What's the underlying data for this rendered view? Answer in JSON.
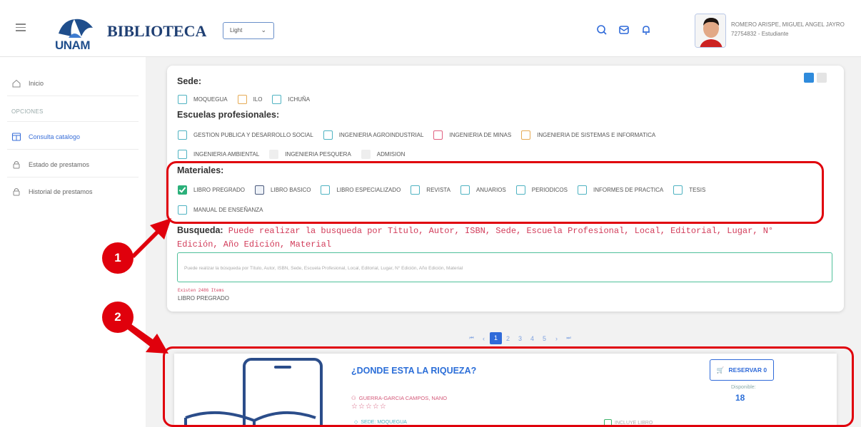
{
  "header": {
    "logo_text": "UNAM",
    "brand": "BIBLIOTECA",
    "theme_select": "Light",
    "user_name": "ROMERO ARISPE, MIGUEL ANGEL JAYRO",
    "user_sub": "72754832 - Estudiante"
  },
  "sidebar": {
    "inicio": "Inicio",
    "section": "OPCIONES",
    "items": [
      "Consulta catalogo",
      "Estado de prestamos",
      "Historial de prestamos"
    ]
  },
  "filters": {
    "sede_label": "Sede:",
    "sedes": [
      "MOQUEGUA",
      "ILO",
      "ICHUÑA"
    ],
    "escuelas_label": "Escuelas profesionales:",
    "escuelas_row1": [
      "GESTION PUBLICA Y DESARROLLO SOCIAL",
      "INGENIERIA AGROINDUSTRIAL",
      "INGENIERIA DE MINAS",
      "INGENIERIA DE SISTEMAS E INFORMATICA"
    ],
    "escuelas_row2": [
      "INGENIERIA AMBIENTAL",
      "INGENIERIA PESQUERA",
      "ADMISION"
    ],
    "materiales_label": "Materiales:",
    "materiales_row1": [
      "LIBRO PREGRADO",
      "LIBRO BASICO",
      "LIBRO ESPECIALIZADO",
      "REVISTA",
      "ANUARIOS",
      "PERIODICOS",
      "INFORMES DE PRACTICA",
      "TESIS"
    ],
    "materiales_row2": [
      "MANUAL DE ENSEÑANZA"
    ],
    "busqueda_label": "Busqueda:",
    "busqueda_hint": "Puede realizar la busqueda por Titulo, Autor, ISBN, Sede, Escuela Profesional, Local, Editorial, Lugar, N° Edición, Año Edición, Material",
    "search_placeholder": "Puede realizar la búsqueda por Título, Autor, ISBN, Sede, Escuela Profesional, Local, Editorial, Lugar, N° Edición, Año Edición, Material",
    "count_text": "Existen 2486 Items",
    "selected_material": "LIBRO PREGRADO"
  },
  "pagination": {
    "first": "⏮",
    "prev": "‹",
    "pages": [
      "1",
      "2",
      "3",
      "4",
      "5"
    ],
    "next": "›",
    "last": "⏭"
  },
  "book": {
    "title": "¿DONDE ESTA LA RIQUEZA?",
    "author": "GUERRA-GARCIA CAMPOS, NANO",
    "stars": "☆☆☆☆☆",
    "reserve": "RESERVAR 0",
    "disponible_label": "Disponible:",
    "disponible_value": "18",
    "sede": "SEDE: MOQUEGUA",
    "incluye": "INCLUYE LIBRO"
  },
  "annotations": {
    "marker1": "1",
    "marker2": "2",
    "color": "#e0000c"
  }
}
